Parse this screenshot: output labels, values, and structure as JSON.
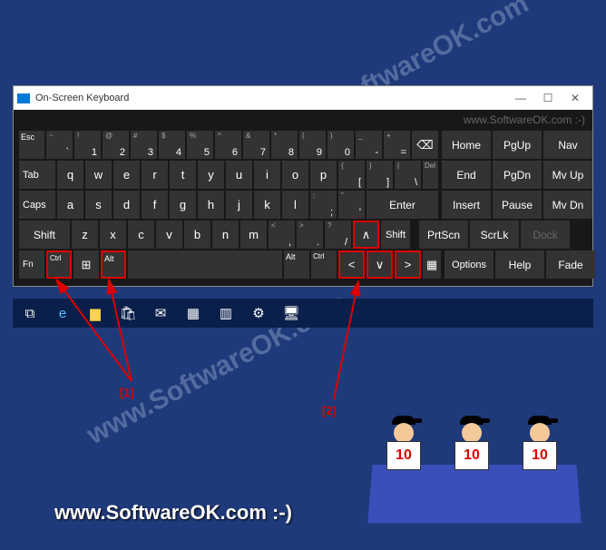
{
  "window": {
    "title": "On-Screen Keyboard",
    "watermark": "www.SoftwareOK.com :-)"
  },
  "rows": {
    "r1": {
      "esc": "Esc",
      "tilde_sup": "~",
      "tilde": "`",
      "1sup": "!",
      "1": "1",
      "2sup": "@",
      "2": "2",
      "3sup": "#",
      "3": "3",
      "4sup": "$",
      "4": "4",
      "5sup": "%",
      "5": "5",
      "6sup": "^",
      "6": "6",
      "7sup": "&",
      "7": "7",
      "8sup": "*",
      "8": "8",
      "9sup": "(",
      "9": "9",
      "0sup": ")",
      "0": "0",
      "minsup": "_",
      "min": "-",
      "eqsup": "+",
      "eq": "=",
      "bksp": "⌫"
    },
    "r2": {
      "tab": "Tab",
      "q": "q",
      "w": "w",
      "e": "e",
      "r": "r",
      "t": "t",
      "y": "y",
      "u": "u",
      "i": "i",
      "o": "o",
      "p": "p",
      "lbrsup": "{",
      "lbr": "[",
      "rbrsup": "}",
      "rbr": "]",
      "bslsup": "|",
      "bsl": "\\",
      "del": "Del"
    },
    "r3": {
      "caps": "Caps",
      "a": "a",
      "s": "s",
      "d": "d",
      "f": "f",
      "g": "g",
      "h": "h",
      "j": "j",
      "k": "k",
      "l": "l",
      "semsup": ":",
      "sem": ";",
      "aposup": "\"",
      "apo": "'",
      "enter": "Enter"
    },
    "r4": {
      "shift": "Shift",
      "z": "z",
      "x": "x",
      "c": "c",
      "v": "v",
      "b": "b",
      "n": "n",
      "m": "m",
      "comsup": "<",
      "com": ",",
      "dotsup": ">",
      "dot": ".",
      "slsup": "?",
      "sl": "/",
      "up": "∧",
      "shift2": "Shift"
    },
    "r5": {
      "fn": "Fn",
      "ctrl": "Ctrl",
      "alt": "Alt",
      "alt2": "Alt",
      "ctrl2": "Ctrl",
      "left": "<",
      "down": "∨",
      "right": ">",
      "menu": "▦"
    }
  },
  "side": {
    "home": "Home",
    "pgup": "PgUp",
    "nav": "Nav",
    "end": "End",
    "pgdn": "PgDn",
    "mvup": "Mv Up",
    "insert": "Insert",
    "pause": "Pause",
    "mvdn": "Mv Dn",
    "prtscn": "PrtScn",
    "scrlk": "ScrLk",
    "dock": "Dock",
    "options": "Options",
    "help": "Help",
    "fade": "Fade"
  },
  "callouts": {
    "c1": "[1]",
    "c2": "[2]"
  },
  "judges": {
    "score": "10"
  },
  "footer": "www.SoftwareOK.com :-)",
  "diag_wm": "www.SoftwareOK.com"
}
